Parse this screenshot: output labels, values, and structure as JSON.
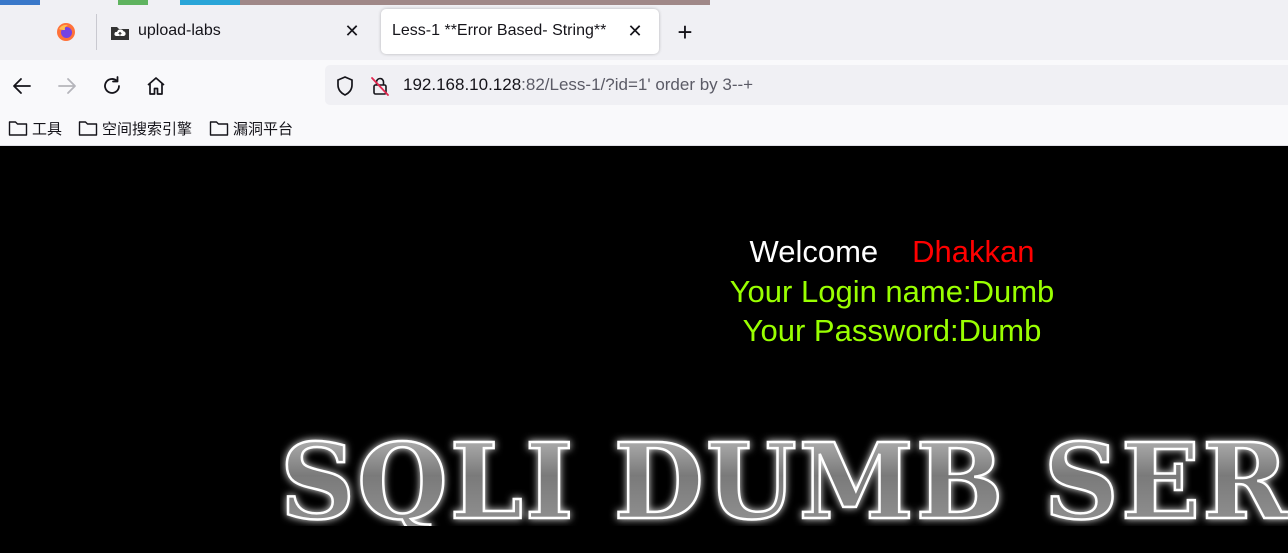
{
  "colors": {
    "tab_strip_bg": "#f0f0f4",
    "toolbar_bg": "#f9f9fb",
    "page_bg": "#000000",
    "welcome_text": "#ffffff",
    "username_text": "#ff0000",
    "login_text": "#99ff00"
  },
  "browser": {
    "menu_icon": "firefox-icon",
    "tabs": [
      {
        "title": "upload-labs",
        "icon": "cloud-folder-icon",
        "active": false
      },
      {
        "title": "Less-1 **Error Based- String**",
        "icon": "",
        "active": true
      }
    ],
    "new_tab_label": "+",
    "close_label": "✕"
  },
  "navbar": {
    "url_host": "192.168.10.128",
    "url_rest": ":82/Less-1/?id=1' order by 3--+"
  },
  "bookmarks": [
    {
      "label": "工具"
    },
    {
      "label": "空间搜索引擎"
    },
    {
      "label": "漏洞平台"
    }
  ],
  "page": {
    "welcome": "Welcome",
    "username": "Dhakkan",
    "login_line": "Your Login name:Dumb",
    "password_line": "Your Password:Dumb",
    "banner_text": "SQLI DUMB SERIES"
  }
}
